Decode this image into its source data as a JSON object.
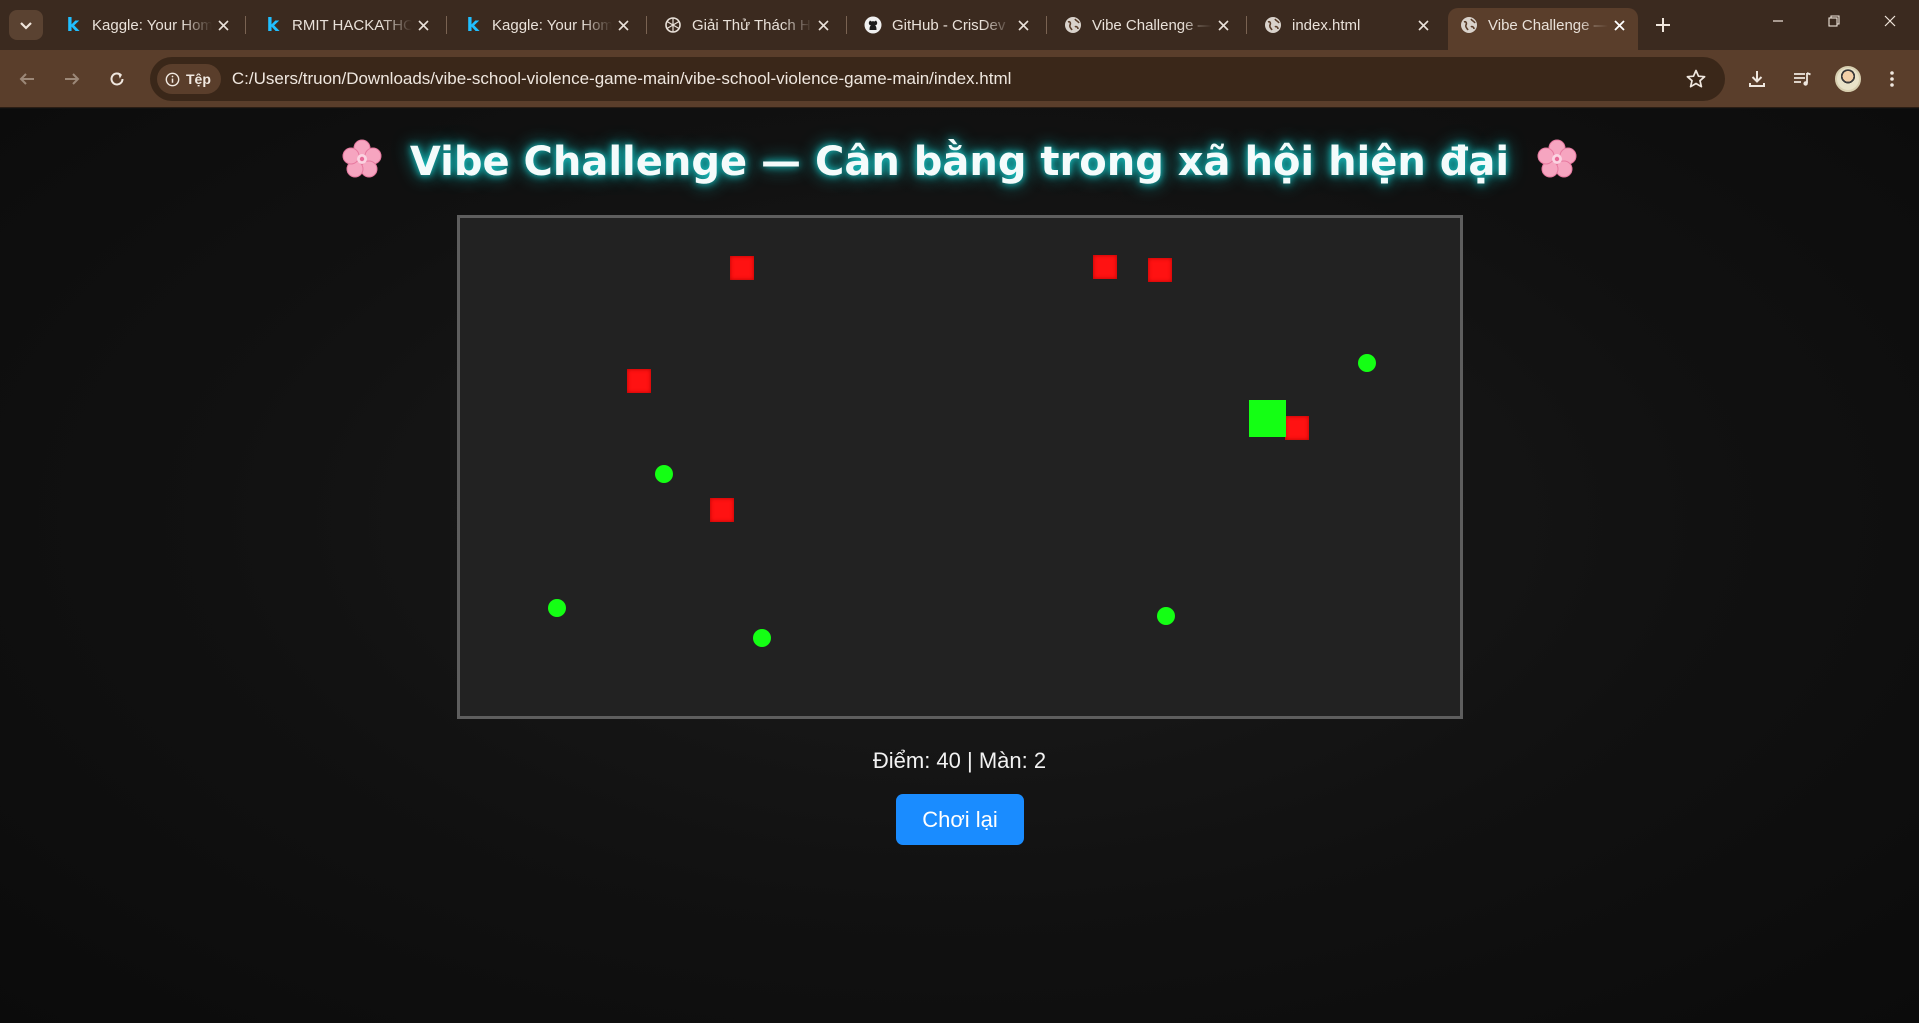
{
  "browser": {
    "tabs": [
      {
        "title": "Kaggle: Your Home for Data Science",
        "favicon": "kaggle-icon"
      },
      {
        "title": "RMIT HACKATHON",
        "favicon": "kaggle-icon"
      },
      {
        "title": "Kaggle: Your Home for Data Science",
        "favicon": "kaggle-icon"
      },
      {
        "title": "Giải Thử Thách Hackathon",
        "favicon": "openai-icon"
      },
      {
        "title": "GitHub - CrisDev",
        "favicon": "github-icon"
      },
      {
        "title": "Vibe Challenge — Cân bằng",
        "favicon": "globe-icon"
      },
      {
        "title": "index.html",
        "favicon": "globe-icon"
      },
      {
        "title": "Vibe Challenge — Cân bằng",
        "favicon": "globe-icon",
        "active": true
      }
    ],
    "omnibox": {
      "chip_label": "Tệp",
      "url": "C:/Users/truon/Downloads/vibe-school-violence-game-main/vibe-school-violence-game-main/index.html"
    },
    "colors": {
      "frame": "#3b2a1f",
      "toolbar": "#5a3e2b"
    }
  },
  "game": {
    "title": "Vibe Challenge — Cân bằng trong xã hội hiện đại",
    "status": "Điểm: 40 | Màn: 2",
    "restart_label": "Chơi lại",
    "colors": {
      "enemy": "#ff1212",
      "coin": "#14ff14",
      "player": "#14ff14",
      "board": "#222222",
      "button": "#1a8cff"
    }
  }
}
